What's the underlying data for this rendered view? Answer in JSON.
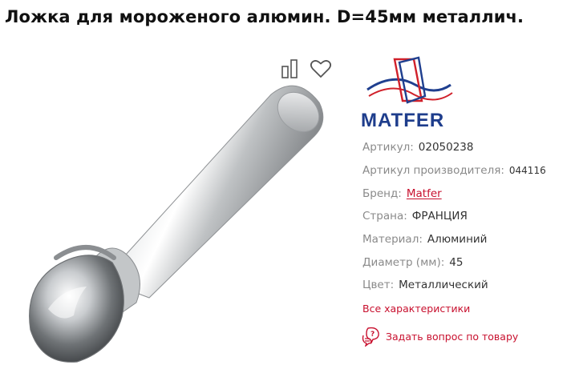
{
  "product": {
    "title": "Ложка для мороженого алюмин. D=45мм металлич."
  },
  "gallery": {
    "image_alt": "ice-cream-scoop",
    "actions": {
      "compare_icon": "compare-icon",
      "favorite_icon": "heart-icon"
    }
  },
  "brand": {
    "logo_text": "MATFER",
    "colors": {
      "blue": "#1f3f8f",
      "red": "#d0202a",
      "text": "#1e3d8c"
    }
  },
  "specs": [
    {
      "label": "Артикул:",
      "value": "02050238"
    },
    {
      "label": "Артикул производителя:",
      "value": "044116"
    },
    {
      "label": "Бренд:",
      "value": "Matfer",
      "link": true
    },
    {
      "label": "Страна:",
      "value": "ФРАНЦИЯ"
    },
    {
      "label": "Материал:",
      "value": "Алюминий"
    },
    {
      "label": "Диаметр (мм):",
      "value": "45"
    },
    {
      "label": "Цвет:",
      "value": "Металлический"
    }
  ],
  "links": {
    "all_specs": "Все характеристики",
    "ask_question": "Задать вопрос по товару"
  },
  "theme": {
    "accent": "#c8102e",
    "label": "#8a8a8a"
  }
}
